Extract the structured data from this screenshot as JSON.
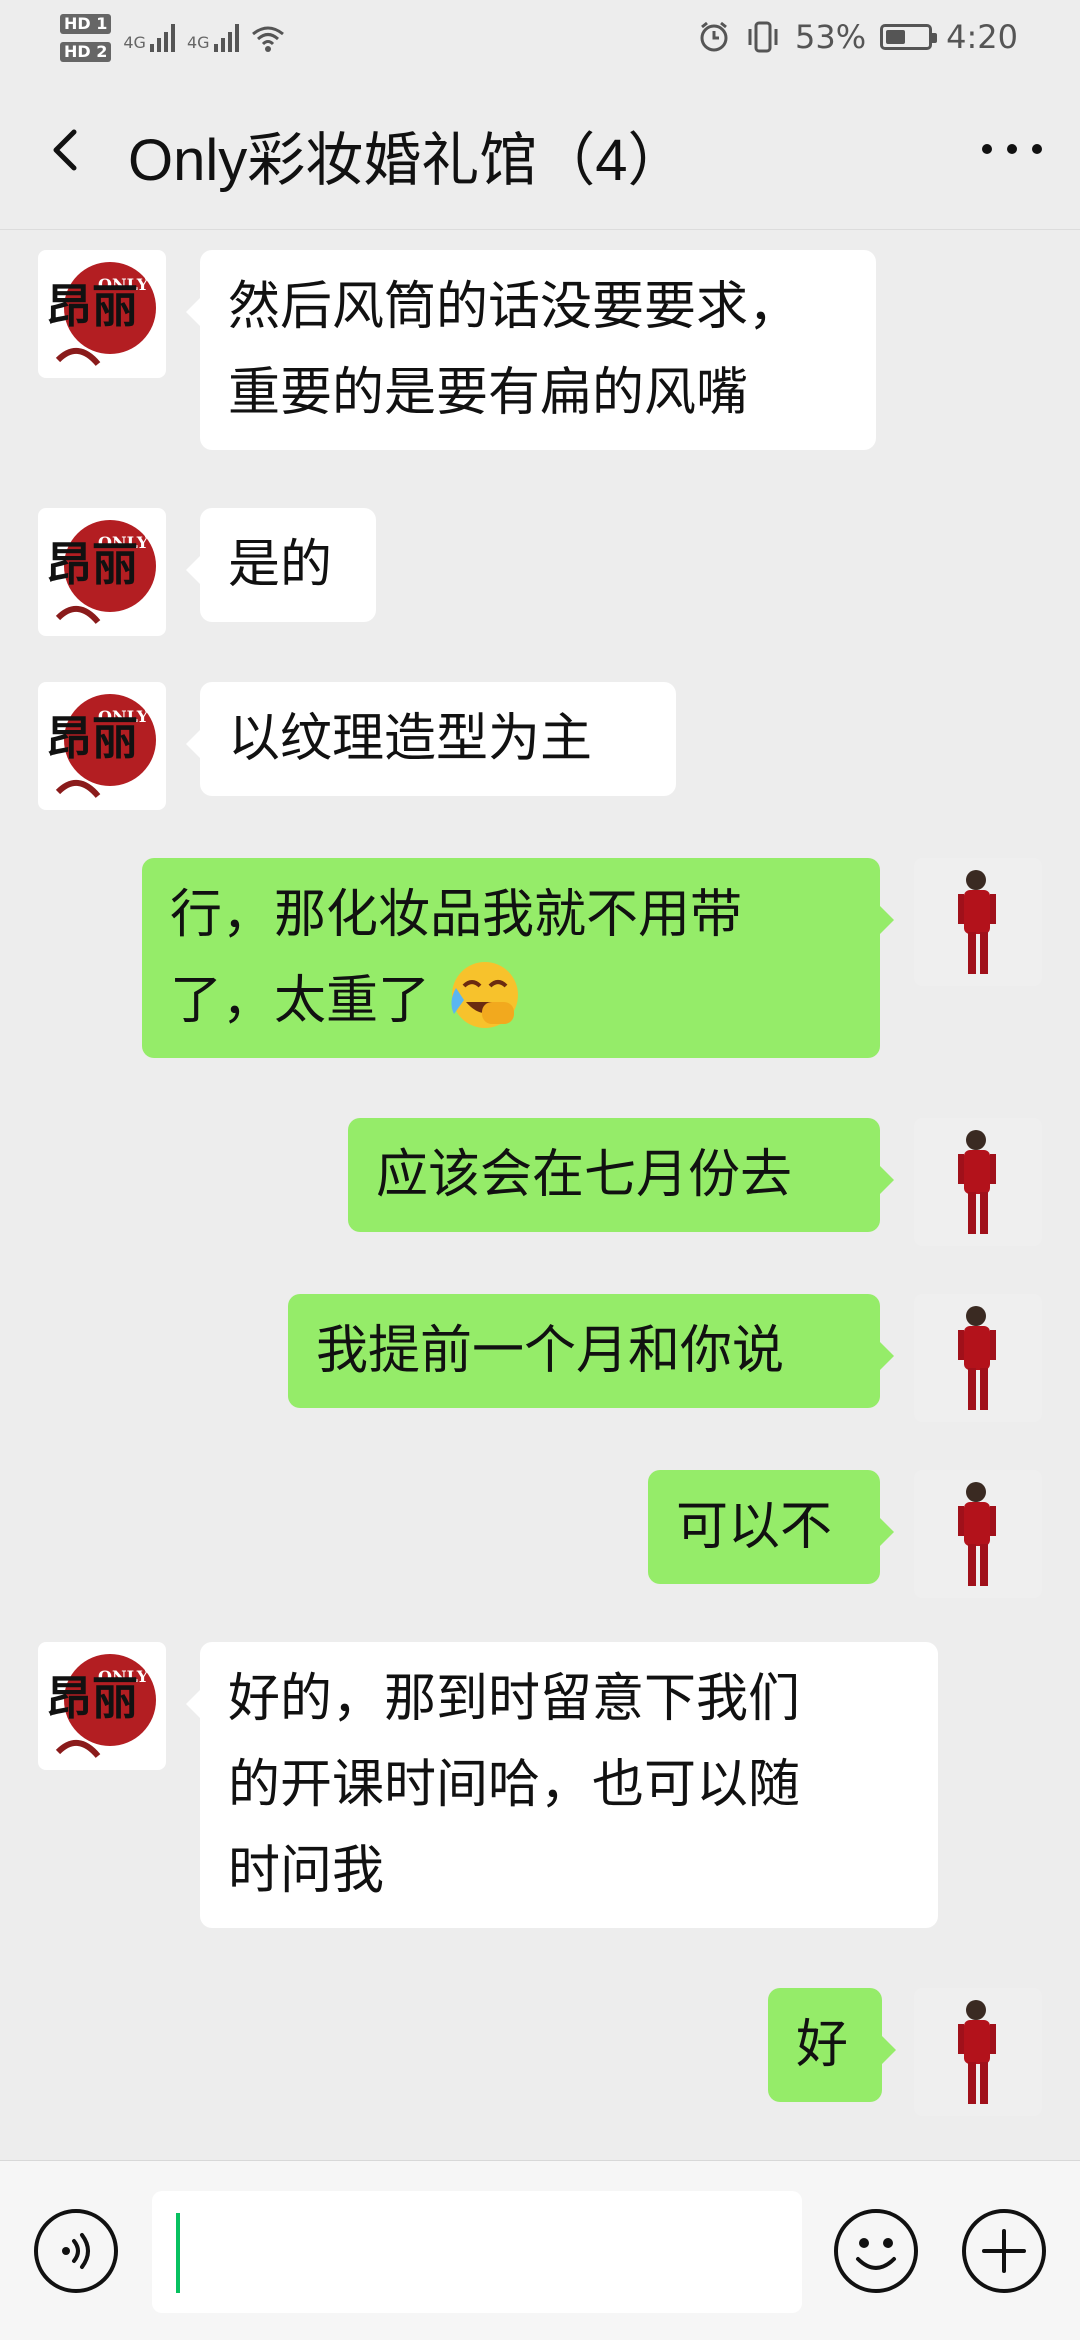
{
  "status": {
    "left_labels": [
      "HD 1",
      "HD 2"
    ],
    "network_1": "4G",
    "network_2": "4G",
    "battery_percent": "53%",
    "battery_level": 0.53,
    "time": "4:20"
  },
  "header": {
    "title": "Only彩妆婚礼馆（4）"
  },
  "messages": [
    {
      "side": "left",
      "text_lines": [
        "然后风筒的话没要要求，",
        "重要的是要有扁的风嘴"
      ]
    },
    {
      "side": "left",
      "text_lines": [
        "是的"
      ]
    },
    {
      "side": "left",
      "text_lines": [
        "以纹理造型为主"
      ]
    },
    {
      "side": "right",
      "text_lines": [
        "行，那化妆品我就不用带",
        "了，太重了"
      ],
      "emoji": "laughing-crying-face"
    },
    {
      "side": "right",
      "text_lines": [
        "应该会在七月份去"
      ]
    },
    {
      "side": "right",
      "text_lines": [
        "我提前一个月和你说"
      ]
    },
    {
      "side": "right",
      "text_lines": [
        "可以不"
      ]
    },
    {
      "side": "left",
      "text_lines": [
        "好的，那到时留意下我们",
        "的开课时间哈，也可以随",
        "时问我"
      ]
    },
    {
      "side": "right",
      "text_lines": [
        "好"
      ]
    }
  ],
  "avatar_logo": {
    "text_top": "ONLY",
    "text_main": "昂丽"
  },
  "colors": {
    "background": "#ededed",
    "outgoing_bubble": "#95ec69",
    "incoming_bubble": "#ffffff",
    "caret": "#07c160"
  }
}
